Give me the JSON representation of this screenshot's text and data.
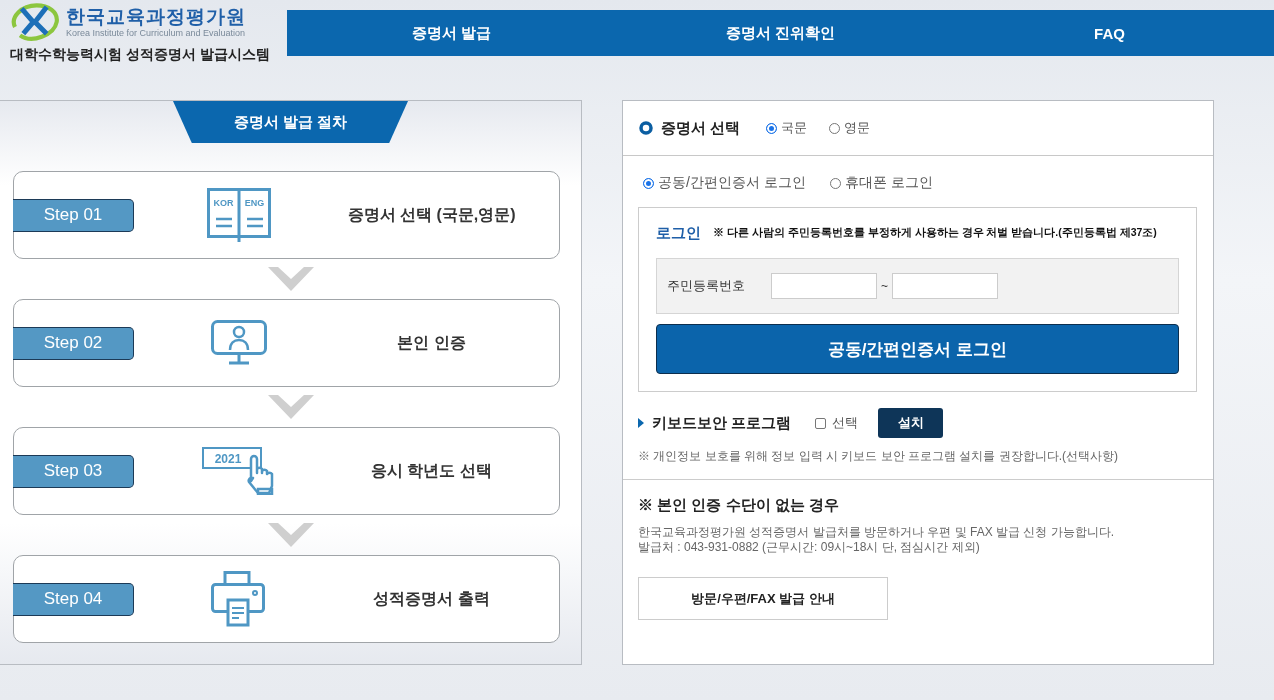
{
  "header": {
    "org_name": "한국교육과정평가원",
    "org_name_en": "Korea Institute for Curriculum and Evaluation",
    "system_title": "대학수학능력시험 성적증명서 발급시스템"
  },
  "nav": [
    {
      "label": "증명서 발급"
    },
    {
      "label": "증명서 진위확인"
    },
    {
      "label": "FAQ"
    }
  ],
  "procedure": {
    "title": "증명서 발급 절차",
    "steps": [
      {
        "label": "Step 01",
        "kind": "book",
        "icon_labels": [
          "KOR",
          "ENG"
        ],
        "text": "증명서 선택 (국문,영문)"
      },
      {
        "label": "Step 02",
        "kind": "monitor",
        "text": "본인 인증"
      },
      {
        "label": "Step 03",
        "kind": "click",
        "icon_labels": [
          "2021"
        ],
        "text": "응시 학년도 선택"
      },
      {
        "label": "Step 04",
        "kind": "printer",
        "text": "성적증명서 출력"
      }
    ]
  },
  "certificate": {
    "title": "증명서 선택",
    "options": [
      {
        "label": "국문",
        "selected": true
      },
      {
        "label": "영문",
        "selected": false
      }
    ]
  },
  "login_methods": [
    {
      "label": "공동/간편인증서 로그인",
      "selected": true
    },
    {
      "label": "휴대폰 로그인",
      "selected": false
    }
  ],
  "login": {
    "title": "로그인",
    "warning": "※ 다른 사람의 주민등록번호를 부정하게 사용하는 경우 처벌 받습니다.(주민등록법 제37조)",
    "field_label": "주민등록번호",
    "separator": "~",
    "button": "공동/간편인증서 로그인"
  },
  "keyboard_security": {
    "title": "키보드보안 프로그램",
    "checkbox": {
      "label": "선택",
      "checked": false
    },
    "install_button": "설치",
    "note": "※ 개인정보 보호를 위해 정보 입력 시 키보드 보안 프로그램 설치를 권장합니다.(선택사항)"
  },
  "no_auth": {
    "title": "※ 본인 인증 수단이 없는 경우",
    "lines": [
      "한국교육과정평가원 성적증명서 발급처를 방문하거나 우편 및 FAX 발급 신청 가능합니다.",
      "발급처 : 043-931-0882 (근무시간: 09시~18시 단, 점심시간 제외)"
    ],
    "button": "방문/우편/FAX 발급 안내"
  }
}
